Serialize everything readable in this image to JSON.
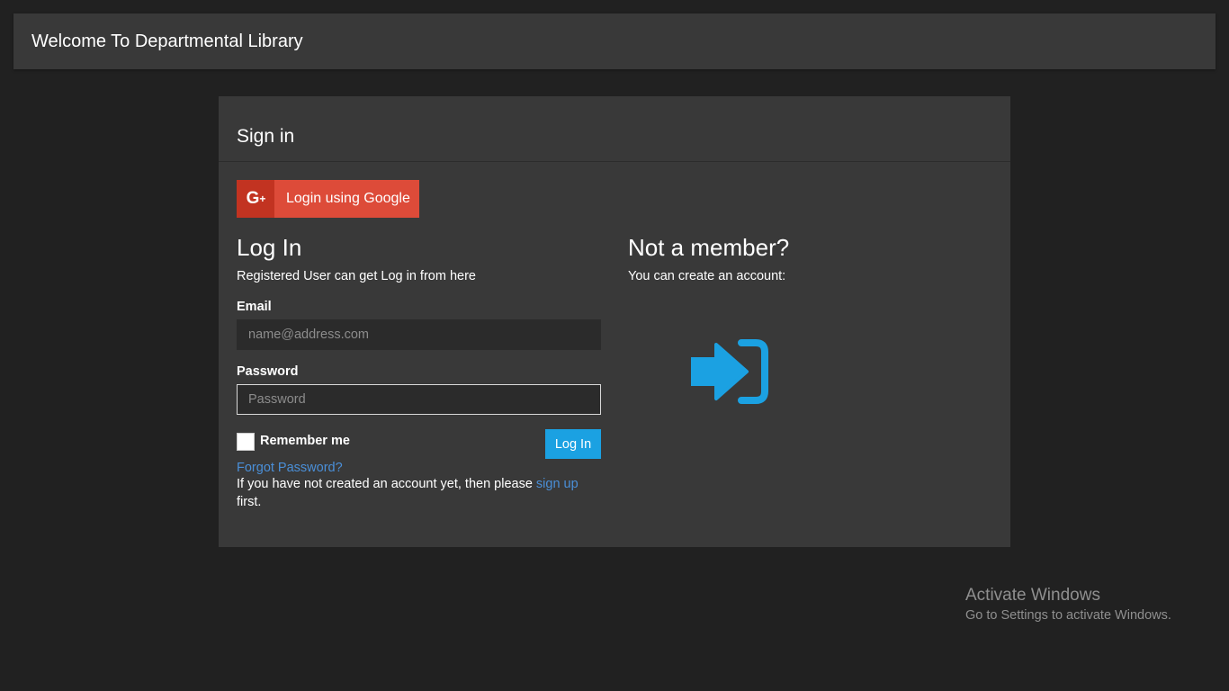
{
  "header": {
    "title": "Welcome To Departmental Library"
  },
  "panel": {
    "title": "Sign in",
    "google_button": {
      "icon_text": "G",
      "icon_sup": "+",
      "label": "Login using Google"
    },
    "login": {
      "heading": "Log In",
      "subtitle": "Registered User can get Log in from here",
      "email_label": "Email",
      "email_placeholder": "name@address.com",
      "password_label": "Password",
      "password_placeholder": "Password",
      "remember_label": "Remember me",
      "login_button": "Log In",
      "forgot_link": "Forgot Password?",
      "signup_prefix": "If you have not created an account yet, then please ",
      "signup_link": "sign up",
      "signup_suffix": "first."
    },
    "register": {
      "heading": "Not a member?",
      "subtitle": "You can create an account:",
      "icon": "sign-in-icon"
    }
  },
  "watermark": {
    "title": "Activate Windows",
    "subtitle": "Go to Settings to activate Windows."
  },
  "colors": {
    "background": "#212121",
    "panel": "#393939",
    "google": "#dd4b39",
    "accent": "#1ba1e2",
    "link": "#4a8fd8"
  }
}
